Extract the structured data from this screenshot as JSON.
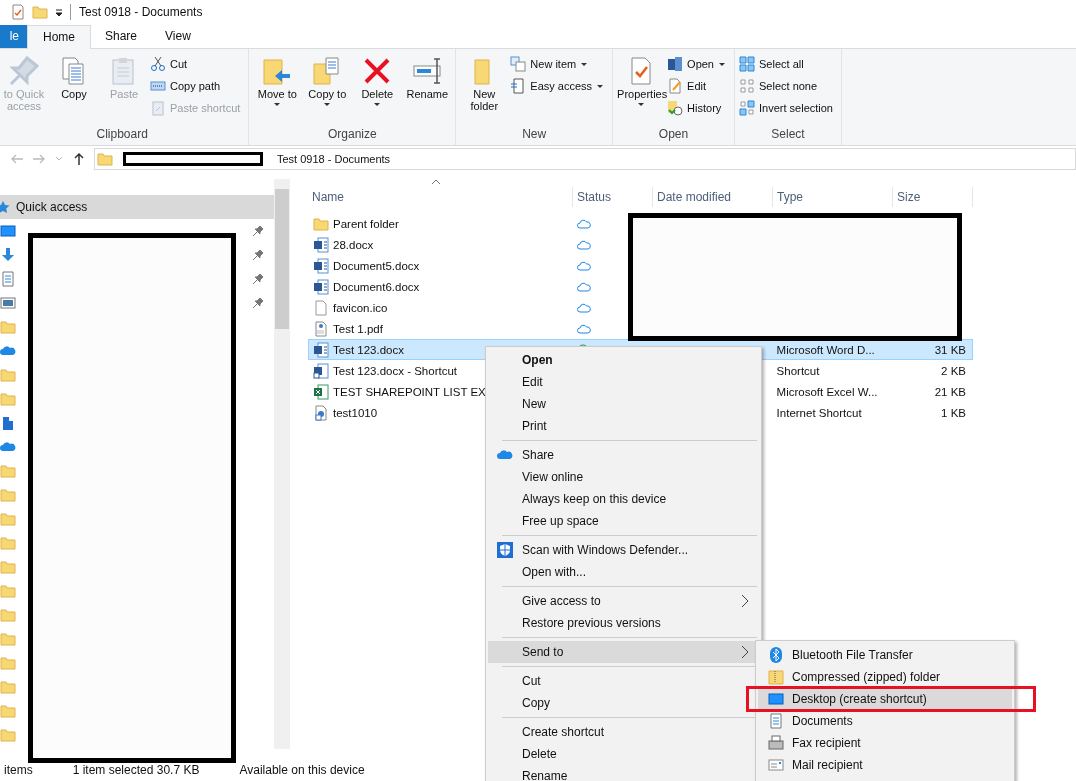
{
  "window": {
    "title": "Test 0918 - Documents"
  },
  "tabs": [
    {
      "label": "le",
      "kind": "file",
      "selected": false
    },
    {
      "label": "Home",
      "kind": "tab",
      "selected": true
    },
    {
      "label": "Share",
      "kind": "tab",
      "selected": false
    },
    {
      "label": "View",
      "kind": "tab",
      "selected": false
    }
  ],
  "ribbon": [
    {
      "label": "Clipboard",
      "columns": [
        {
          "kind": "large",
          "items": [
            {
              "label": "to Quick access",
              "disabled": true,
              "dropdown": false
            }
          ]
        },
        {
          "kind": "large",
          "items": [
            {
              "label": "Copy",
              "disabled": false,
              "dropdown": false
            }
          ]
        },
        {
          "kind": "large",
          "items": [
            {
              "label": "Paste",
              "disabled": true,
              "dropdown": false
            }
          ]
        },
        {
          "kind": "small",
          "items": [
            {
              "label": "Cut",
              "disabled": false,
              "dropdown": false
            },
            {
              "label": "Copy path",
              "disabled": false,
              "dropdown": false
            },
            {
              "label": "Paste shortcut",
              "disabled": true,
              "dropdown": false
            }
          ]
        }
      ]
    },
    {
      "label": "Organize",
      "columns": [
        {
          "kind": "large",
          "items": [
            {
              "label": "Move to",
              "disabled": false,
              "dropdown": true
            }
          ]
        },
        {
          "kind": "large",
          "items": [
            {
              "label": "Copy to",
              "disabled": false,
              "dropdown": true
            }
          ]
        },
        {
          "kind": "large",
          "items": [
            {
              "label": "Delete",
              "disabled": false,
              "dropdown": true
            }
          ]
        },
        {
          "kind": "large",
          "items": [
            {
              "label": "Rename",
              "disabled": false,
              "dropdown": false
            }
          ]
        }
      ]
    },
    {
      "label": "New",
      "columns": [
        {
          "kind": "large",
          "items": [
            {
              "label": "New folder",
              "disabled": false,
              "dropdown": false
            }
          ]
        },
        {
          "kind": "small",
          "items": [
            {
              "label": "New item",
              "disabled": false,
              "dropdown": true
            },
            {
              "label": "Easy access",
              "disabled": false,
              "dropdown": true
            }
          ]
        }
      ]
    },
    {
      "label": "Open",
      "columns": [
        {
          "kind": "large",
          "items": [
            {
              "label": "Properties",
              "disabled": false,
              "dropdown": true
            }
          ]
        },
        {
          "kind": "small",
          "items": [
            {
              "label": "Open",
              "disabled": false,
              "dropdown": true
            },
            {
              "label": "Edit",
              "disabled": false,
              "dropdown": false
            },
            {
              "label": "History",
              "disabled": false,
              "dropdown": false
            }
          ]
        }
      ]
    },
    {
      "label": "Select",
      "columns": [
        {
          "kind": "small",
          "items": [
            {
              "label": "Select all",
              "disabled": false,
              "dropdown": false
            },
            {
              "label": "Select none",
              "disabled": false,
              "dropdown": false
            },
            {
              "label": "Invert selection",
              "disabled": false,
              "dropdown": false
            }
          ]
        }
      ]
    }
  ],
  "address": {
    "path": "Test 0918 - Documents"
  },
  "sidebar": {
    "header": "Quick access",
    "items": [
      {
        "kind": "desktop",
        "pinned": true
      },
      {
        "kind": "downloads",
        "pinned": true
      },
      {
        "kind": "documents",
        "pinned": true
      },
      {
        "kind": "pictures",
        "pinned": true
      },
      {
        "kind": "folder",
        "pinned": false
      },
      {
        "kind": "onedrive",
        "pinned": false
      },
      {
        "kind": "folder",
        "pinned": false
      },
      {
        "kind": "folder",
        "pinned": false
      },
      {
        "kind": "building",
        "pinned": false
      },
      {
        "kind": "onedrive",
        "pinned": false
      },
      {
        "kind": "folder",
        "pinned": false
      },
      {
        "kind": "folder",
        "pinned": false
      },
      {
        "kind": "folder",
        "pinned": false
      },
      {
        "kind": "folder",
        "pinned": false
      },
      {
        "kind": "folder",
        "pinned": false
      },
      {
        "kind": "folder",
        "pinned": false
      },
      {
        "kind": "folder",
        "pinned": false
      },
      {
        "kind": "folder",
        "pinned": false
      },
      {
        "kind": "folder",
        "pinned": false
      },
      {
        "kind": "folder",
        "pinned": false
      },
      {
        "kind": "folder",
        "pinned": false
      },
      {
        "kind": "folder",
        "pinned": false
      }
    ]
  },
  "table": {
    "columns": [
      "Name",
      "Status",
      "Date modified",
      "Type",
      "Size"
    ],
    "rows": [
      {
        "name": "Parent folder",
        "kind": "folder",
        "online_only": true,
        "synced": false,
        "selected": false
      },
      {
        "name": "28.docx",
        "kind": "word",
        "online_only": true,
        "synced": false,
        "selected": false
      },
      {
        "name": "Document5.docx",
        "kind": "word",
        "online_only": true,
        "synced": false,
        "selected": false
      },
      {
        "name": "Document6.docx",
        "kind": "word",
        "online_only": true,
        "synced": false,
        "selected": false
      },
      {
        "name": "favicon.ico",
        "kind": "blank",
        "online_only": true,
        "synced": false,
        "selected": false
      },
      {
        "name": "Test 1.pdf",
        "kind": "pdf",
        "online_only": true,
        "synced": false,
        "selected": false
      },
      {
        "name": "Test 123.docx",
        "kind": "word",
        "online_only": false,
        "synced": true,
        "type": "Microsoft Word D...",
        "size": "31 KB",
        "selected": true
      },
      {
        "name": "Test 123.docx - Shortcut",
        "kind": "shortcut",
        "type": "Shortcut",
        "size": "2 KB",
        "selected": false
      },
      {
        "name": "TEST SHAREPOINT LIST EX",
        "kind": "excel",
        "type": "Microsoft Excel W...",
        "size": "21 KB",
        "selected": false
      },
      {
        "name": "test1010",
        "kind": "link",
        "type": "Internet Shortcut",
        "size": "1 KB",
        "selected": false
      }
    ]
  },
  "status_bar": [
    "items",
    "1 item selected  30.7 KB",
    "Available on this device"
  ],
  "context_menu": {
    "groups": [
      [
        {
          "label": "Open",
          "bold": true,
          "submenu": false,
          "selected": false
        },
        {
          "label": "Edit",
          "bold": false,
          "submenu": false,
          "selected": false
        },
        {
          "label": "New",
          "bold": false,
          "submenu": false,
          "selected": false
        },
        {
          "label": "Print",
          "bold": false,
          "submenu": false,
          "selected": false
        }
      ],
      [
        {
          "label": "Share",
          "bold": false,
          "submenu": false,
          "selected": false
        },
        {
          "label": "View online",
          "bold": false,
          "submenu": false,
          "selected": false
        },
        {
          "label": "Always keep on this device",
          "bold": false,
          "submenu": false,
          "selected": false
        },
        {
          "label": "Free up space",
          "bold": false,
          "submenu": false,
          "selected": false
        }
      ],
      [
        {
          "label": "Scan with Windows Defender...",
          "bold": false,
          "submenu": false,
          "selected": false
        },
        {
          "label": "Open with...",
          "bold": false,
          "submenu": false,
          "selected": false
        }
      ],
      [
        {
          "label": "Give access to",
          "bold": false,
          "submenu": true,
          "selected": false
        },
        {
          "label": "Restore previous versions",
          "bold": false,
          "submenu": false,
          "selected": false
        }
      ],
      [
        {
          "label": "Send to",
          "bold": false,
          "submenu": true,
          "selected": true
        }
      ],
      [
        {
          "label": "Cut",
          "bold": false,
          "submenu": false,
          "selected": false
        },
        {
          "label": "Copy",
          "bold": false,
          "submenu": false,
          "selected": false
        }
      ],
      [
        {
          "label": "Create shortcut",
          "bold": false,
          "submenu": false,
          "selected": false
        },
        {
          "label": "Delete",
          "bold": false,
          "submenu": false,
          "selected": false
        },
        {
          "label": "Rename",
          "bold": false,
          "submenu": false,
          "selected": false
        }
      ]
    ]
  },
  "send_to_menu": {
    "items": [
      {
        "label": "Bluetooth File Transfer",
        "selected": false
      },
      {
        "label": "Compressed (zipped) folder",
        "selected": false
      },
      {
        "label": "Desktop (create shortcut)",
        "selected": true
      },
      {
        "label": "Documents",
        "selected": false
      },
      {
        "label": "Fax recipient",
        "selected": false
      },
      {
        "label": "Mail recipient",
        "selected": false
      }
    ]
  }
}
